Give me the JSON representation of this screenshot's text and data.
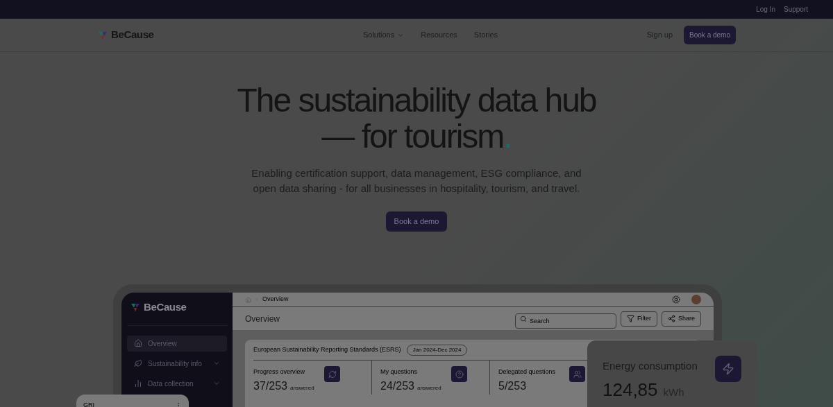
{
  "top_bar": {
    "links": [
      "Log In",
      "Support"
    ]
  },
  "nav": {
    "logo": "BeCause",
    "items": [
      {
        "label": "Solutions",
        "dropdown": true
      },
      {
        "label": "Resources",
        "dropdown": false
      },
      {
        "label": "Stories",
        "dropdown": false
      }
    ],
    "sign_up": "Sign up",
    "cta": "Book a demo"
  },
  "hero": {
    "title_line_1": "The sustainability data hub",
    "title_line_2": "— for tourism",
    "title_dot": ".",
    "subtitle": "Enabling certification support, data management, ESG compliance, and open data sharing - for all businesses in hospitality, tourism, and travel.",
    "button": "Book a demo"
  },
  "dashboard": {
    "logo": "BeCause",
    "sidebar": [
      {
        "label": "Overview",
        "expandable": false,
        "selected": true
      },
      {
        "label": "Sustainability info",
        "expandable": true,
        "selected": false
      },
      {
        "label": "Data collection",
        "expandable": true,
        "selected": false
      }
    ],
    "breadcrumb": "Overview",
    "page_title": "Overview",
    "search": {
      "placeholder": "Search"
    },
    "buttons": [
      {
        "label": "Filter"
      },
      {
        "label": "Share"
      }
    ],
    "card": {
      "title": "European Sustainability Reporting Standards (ESRS)",
      "date": "Jan 2024-Dec 2024",
      "stats": [
        {
          "label": "Progress overview",
          "value": "37/253",
          "suffix": "answered"
        },
        {
          "label": "My questions",
          "value": "24/253",
          "suffix": "answered"
        },
        {
          "label": "Delegated questions",
          "value": "5/253"
        }
      ]
    },
    "energy": {
      "title": "Energy consumption",
      "value": "124,85",
      "unit": "kWh"
    },
    "gri": {
      "title": "GRI"
    }
  }
}
